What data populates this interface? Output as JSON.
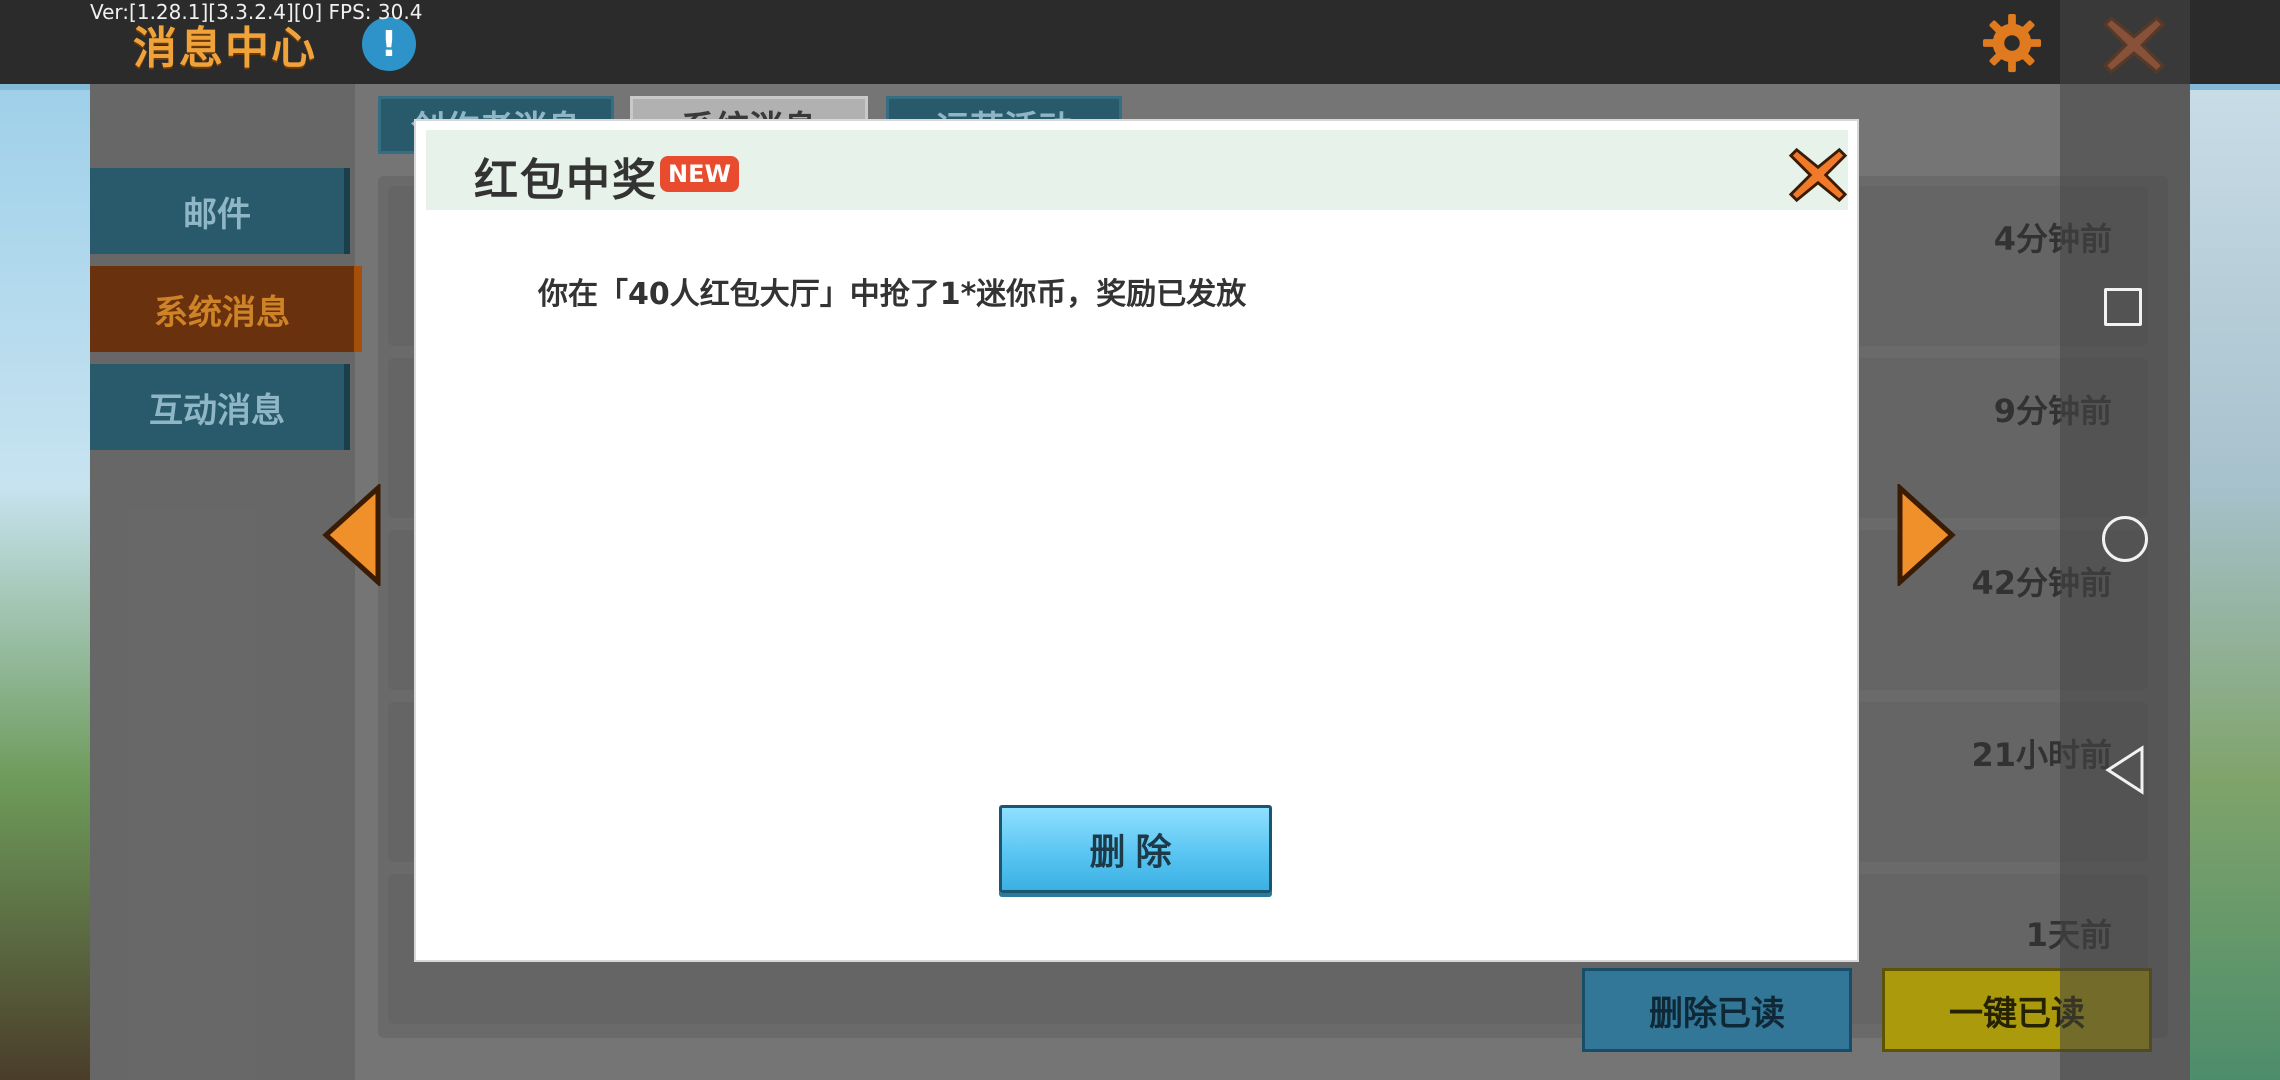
{
  "debug": {
    "fps_text": "Ver:[1.28.1][3.3.2.4][0] FPS: 30.4"
  },
  "header": {
    "title": "消息中心",
    "info_icon_glyph": "!",
    "accent_color": "#f0a33a"
  },
  "sidebar": {
    "items": [
      {
        "label": "邮件"
      },
      {
        "label": "系统消息"
      },
      {
        "label": "互动消息"
      }
    ]
  },
  "tabs": [
    {
      "label": "创作者消息"
    },
    {
      "label": "系统消息"
    },
    {
      "label": "运营活动"
    }
  ],
  "messages": [
    {
      "time": "4分钟前"
    },
    {
      "time": "9分钟前"
    },
    {
      "time": "42分钟前"
    },
    {
      "time": "21小时前"
    },
    {
      "time": "1天前"
    }
  ],
  "footer": {
    "delete_read_label": "删除已读",
    "mark_all_read_label": "一键已读"
  },
  "dialog": {
    "title": "红包中奖",
    "badge": "NEW",
    "message": "你在「40人红包大厅」中抢了1*迷你币，奖励已发放",
    "delete_label": "删除"
  },
  "icons": {
    "gear": "gear-icon",
    "close": "close-icon",
    "prev": "arrow-left-icon",
    "next": "arrow-right-icon"
  }
}
